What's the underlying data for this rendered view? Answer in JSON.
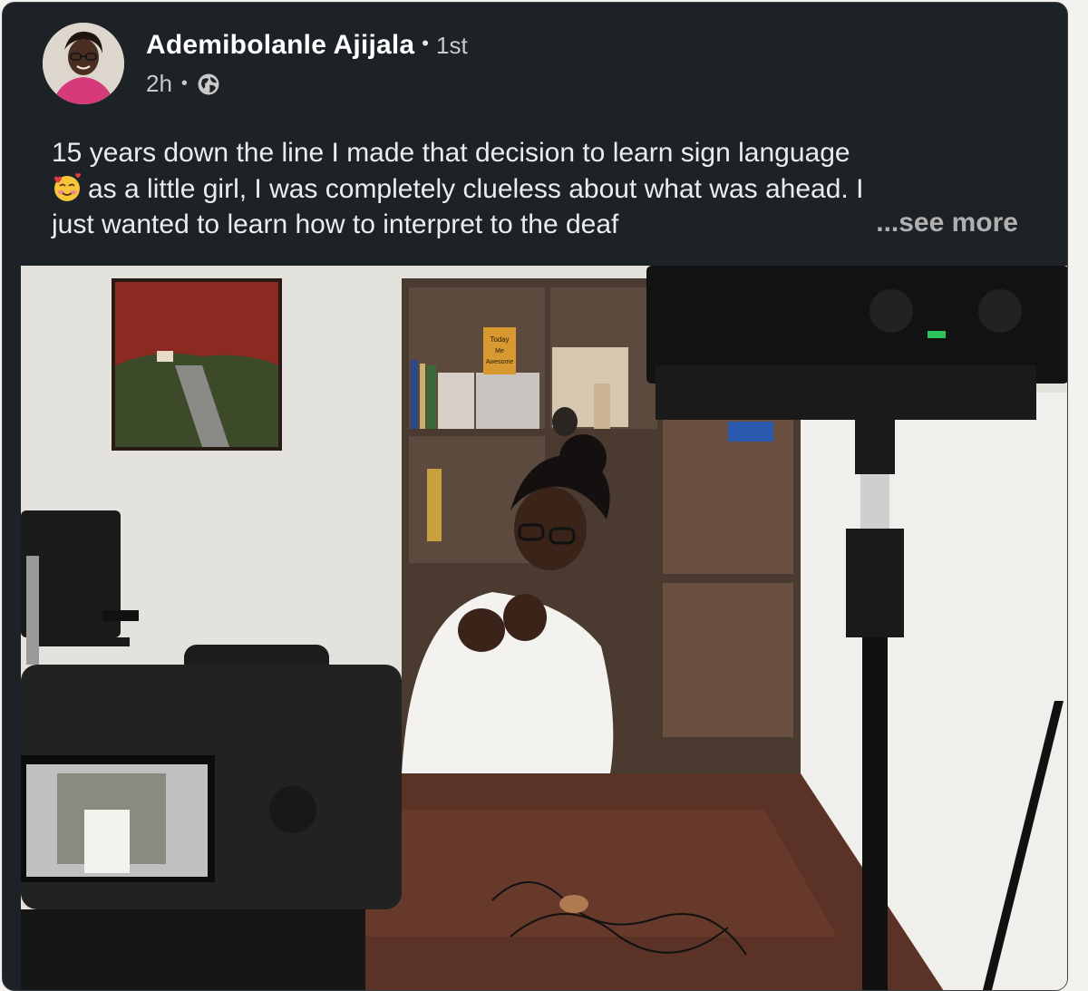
{
  "post": {
    "author": {
      "name": "Ademibolanle Ajijala",
      "degree": "1st",
      "avatar_icon": "profile-photo"
    },
    "meta": {
      "timestamp": "2h",
      "separator": "•",
      "visibility_icon": "globe-icon"
    },
    "text": {
      "line1": "15 years down the line I made that decision to learn sign language",
      "emoji": "smiling-face-with-hearts",
      "line2": "as a little girl, I was completely clueless about what was ahead. I",
      "line3": "just wanted to learn how to interpret to the deaf"
    },
    "see_more_label": "...see more",
    "image": {
      "book_label_line1": "Today",
      "book_label_line2": "Me",
      "book_label_line3": "Awesome"
    }
  },
  "colors": {
    "card_background": "#1d2226",
    "text_primary": "#ffffff",
    "text_secondary": "#c9c9c9"
  }
}
